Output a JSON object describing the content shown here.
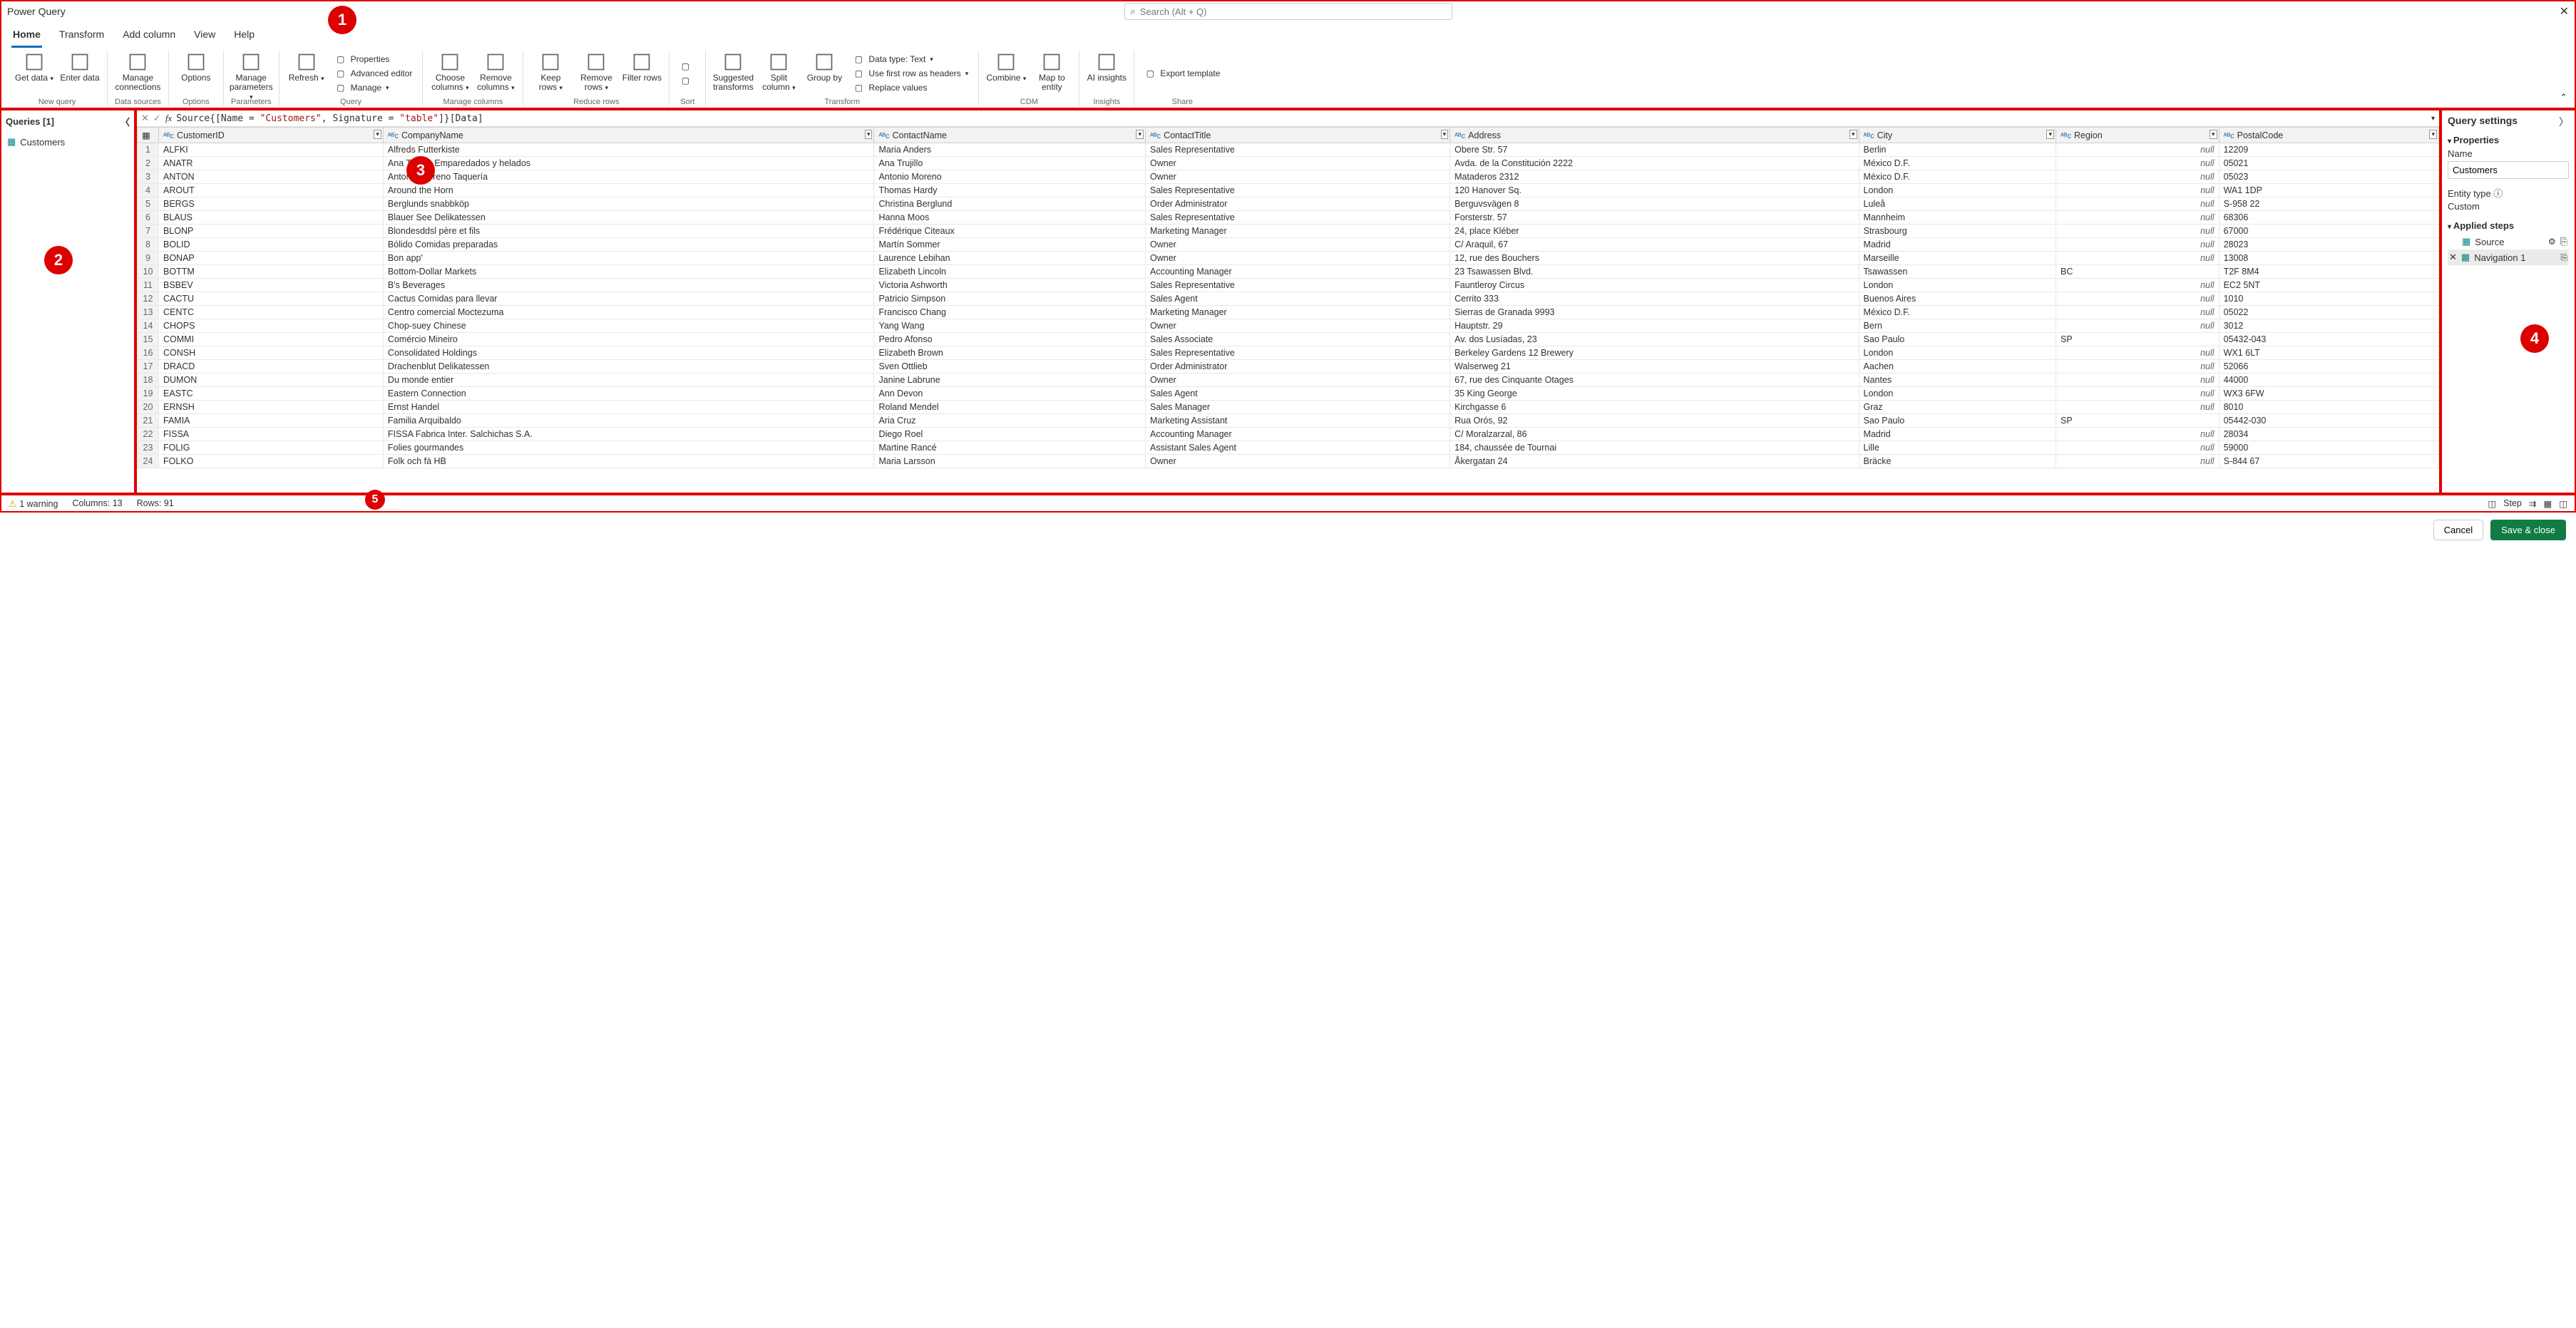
{
  "window_title": "Power Query",
  "search_placeholder": "Search (Alt + Q)",
  "ribbon_tabs": [
    "Home",
    "Transform",
    "Add column",
    "View",
    "Help"
  ],
  "active_tab": "Home",
  "ribbon_groups": [
    {
      "label": "New query",
      "big": [
        {
          "name": "get-data",
          "label": "Get data",
          "caret": true
        },
        {
          "name": "enter-data",
          "label": "Enter data"
        }
      ]
    },
    {
      "label": "Data sources",
      "big": [
        {
          "name": "manage-connections",
          "label": "Manage connections"
        }
      ]
    },
    {
      "label": "Options",
      "big": [
        {
          "name": "options",
          "label": "Options"
        }
      ]
    },
    {
      "label": "Parameters",
      "big": [
        {
          "name": "manage-parameters",
          "label": "Manage parameters",
          "caret": true
        }
      ]
    },
    {
      "label": "Query",
      "big": [
        {
          "name": "refresh",
          "label": "Refresh",
          "caret": true
        }
      ],
      "small": [
        {
          "name": "properties",
          "label": "Properties"
        },
        {
          "name": "advanced-editor",
          "label": "Advanced editor"
        },
        {
          "name": "manage",
          "label": "Manage",
          "caret": true
        }
      ]
    },
    {
      "label": "Manage columns",
      "big": [
        {
          "name": "choose-columns",
          "label": "Choose columns",
          "caret": true
        },
        {
          "name": "remove-columns",
          "label": "Remove columns",
          "caret": true
        }
      ]
    },
    {
      "label": "Reduce rows",
      "big": [
        {
          "name": "keep-rows",
          "label": "Keep rows",
          "caret": true
        },
        {
          "name": "remove-rows",
          "label": "Remove rows",
          "caret": true
        },
        {
          "name": "filter-rows",
          "label": "Filter rows"
        }
      ]
    },
    {
      "label": "Sort",
      "small": [
        {
          "name": "sort-asc",
          "label": ""
        },
        {
          "name": "sort-desc",
          "label": ""
        }
      ]
    },
    {
      "label": "Transform",
      "big": [
        {
          "name": "suggested-transforms",
          "label": "Suggested transforms"
        },
        {
          "name": "split-column",
          "label": "Split column",
          "caret": true
        },
        {
          "name": "group-by",
          "label": "Group by"
        }
      ],
      "small": [
        {
          "name": "data-type",
          "label": "Data type: Text",
          "caret": true
        },
        {
          "name": "first-row-headers",
          "label": "Use first row as headers",
          "caret": true
        },
        {
          "name": "replace-values",
          "label": "Replace values"
        }
      ]
    },
    {
      "label": "CDM",
      "big": [
        {
          "name": "combine",
          "label": "Combine",
          "caret": true
        },
        {
          "name": "map-to-entity",
          "label": "Map to entity"
        }
      ]
    },
    {
      "label": "Insights",
      "big": [
        {
          "name": "ai-insights",
          "label": "AI insights"
        }
      ]
    },
    {
      "label": "Share",
      "small": [
        {
          "name": "export-template",
          "label": "Export template"
        }
      ]
    }
  ],
  "queries": {
    "header": "Queries [1]",
    "items": [
      {
        "name": "Customers"
      }
    ]
  },
  "formula": {
    "prefix": "Source{[Name = ",
    "str1": "\"Customers\"",
    "mid": ", Signature = ",
    "str2": "\"table\"",
    "suffix": "]}[Data]"
  },
  "columns": [
    "CustomerID",
    "CompanyName",
    "ContactName",
    "ContactTitle",
    "Address",
    "City",
    "Region",
    "PostalCode"
  ],
  "rows": [
    [
      "ALFKI",
      "Alfreds Futterkiste",
      "Maria Anders",
      "Sales Representative",
      "Obere Str. 57",
      "Berlin",
      null,
      "12209"
    ],
    [
      "ANATR",
      "Ana Trujillo Emparedados y helados",
      "Ana Trujillo",
      "Owner",
      "Avda. de la Constitución 2222",
      "México D.F.",
      null,
      "05021"
    ],
    [
      "ANTON",
      "Antonio Moreno Taquería",
      "Antonio Moreno",
      "Owner",
      "Mataderos  2312",
      "México D.F.",
      null,
      "05023"
    ],
    [
      "AROUT",
      "Around the Horn",
      "Thomas Hardy",
      "Sales Representative",
      "120 Hanover Sq.",
      "London",
      null,
      "WA1 1DP"
    ],
    [
      "BERGS",
      "Berglunds snabbköp",
      "Christina Berglund",
      "Order Administrator",
      "Berguvsvägen  8",
      "Luleå",
      null,
      "S-958 22"
    ],
    [
      "BLAUS",
      "Blauer See Delikatessen",
      "Hanna Moos",
      "Sales Representative",
      "Forsterstr. 57",
      "Mannheim",
      null,
      "68306"
    ],
    [
      "BLONP",
      "Blondesddsl père et fils",
      "Frédérique Citeaux",
      "Marketing Manager",
      "24, place Kléber",
      "Strasbourg",
      null,
      "67000"
    ],
    [
      "BOLID",
      "Bólido Comidas preparadas",
      "Martín Sommer",
      "Owner",
      "C/ Araquil, 67",
      "Madrid",
      null,
      "28023"
    ],
    [
      "BONAP",
      "Bon app'",
      "Laurence Lebihan",
      "Owner",
      "12, rue des Bouchers",
      "Marseille",
      null,
      "13008"
    ],
    [
      "BOTTM",
      "Bottom-Dollar Markets",
      "Elizabeth Lincoln",
      "Accounting Manager",
      "23 Tsawassen Blvd.",
      "Tsawassen",
      "BC",
      "T2F 8M4"
    ],
    [
      "BSBEV",
      "B's Beverages",
      "Victoria Ashworth",
      "Sales Representative",
      "Fauntleroy Circus",
      "London",
      null,
      "EC2 5NT"
    ],
    [
      "CACTU",
      "Cactus Comidas para llevar",
      "Patricio Simpson",
      "Sales Agent",
      "Cerrito 333",
      "Buenos Aires",
      null,
      "1010"
    ],
    [
      "CENTC",
      "Centro comercial Moctezuma",
      "Francisco Chang",
      "Marketing Manager",
      "Sierras de Granada 9993",
      "México D.F.",
      null,
      "05022"
    ],
    [
      "CHOPS",
      "Chop-suey Chinese",
      "Yang Wang",
      "Owner",
      "Hauptstr. 29",
      "Bern",
      null,
      "3012"
    ],
    [
      "COMMI",
      "Comércio Mineiro",
      "Pedro Afonso",
      "Sales Associate",
      "Av. dos Lusíadas, 23",
      "Sao Paulo",
      "SP",
      "05432-043"
    ],
    [
      "CONSH",
      "Consolidated Holdings",
      "Elizabeth Brown",
      "Sales Representative",
      "Berkeley Gardens 12  Brewery",
      "London",
      null,
      "WX1 6LT"
    ],
    [
      "DRACD",
      "Drachenblut Delikatessen",
      "Sven Ottlieb",
      "Order Administrator",
      "Walserweg 21",
      "Aachen",
      null,
      "52066"
    ],
    [
      "DUMON",
      "Du monde entier",
      "Janine Labrune",
      "Owner",
      "67, rue des Cinquante Otages",
      "Nantes",
      null,
      "44000"
    ],
    [
      "EASTC",
      "Eastern Connection",
      "Ann Devon",
      "Sales Agent",
      "35 King George",
      "London",
      null,
      "WX3 6FW"
    ],
    [
      "ERNSH",
      "Ernst Handel",
      "Roland Mendel",
      "Sales Manager",
      "Kirchgasse 6",
      "Graz",
      null,
      "8010"
    ],
    [
      "FAMIA",
      "Familia Arquibaldo",
      "Aria Cruz",
      "Marketing Assistant",
      "Rua Orós, 92",
      "Sao Paulo",
      "SP",
      "05442-030"
    ],
    [
      "FISSA",
      "FISSA Fabrica Inter. Salchichas S.A.",
      "Diego Roel",
      "Accounting Manager",
      "C/ Moralzarzal, 86",
      "Madrid",
      null,
      "28034"
    ],
    [
      "FOLIG",
      "Folies gourmandes",
      "Martine Rancé",
      "Assistant Sales Agent",
      "184, chaussée de Tournai",
      "Lille",
      null,
      "59000"
    ],
    [
      "FOLKO",
      "Folk och fä HB",
      "Maria Larsson",
      "Owner",
      "Åkergatan 24",
      "Bräcke",
      null,
      "S-844 67"
    ]
  ],
  "null_text": "null",
  "settings": {
    "title": "Query settings",
    "properties_section": "Properties",
    "name_label": "Name",
    "name_value": "Customers",
    "entity_type_label": "Entity type ⓘ",
    "entity_type_value": "Custom",
    "steps_section": "Applied steps",
    "steps": [
      {
        "label": "Source",
        "icon": "table",
        "gear": true
      },
      {
        "label": "Navigation 1",
        "icon": "table",
        "selected": true,
        "delete": true
      }
    ]
  },
  "statusbar": {
    "warning": "1 warning",
    "columns": "Columns: 13",
    "rows": "Rows: 91",
    "step_label": "Step"
  },
  "footer": {
    "cancel": "Cancel",
    "save": "Save & close"
  },
  "badges": {
    "b1": "1",
    "b2": "2",
    "b3": "3",
    "b4": "4",
    "b5": "5"
  }
}
